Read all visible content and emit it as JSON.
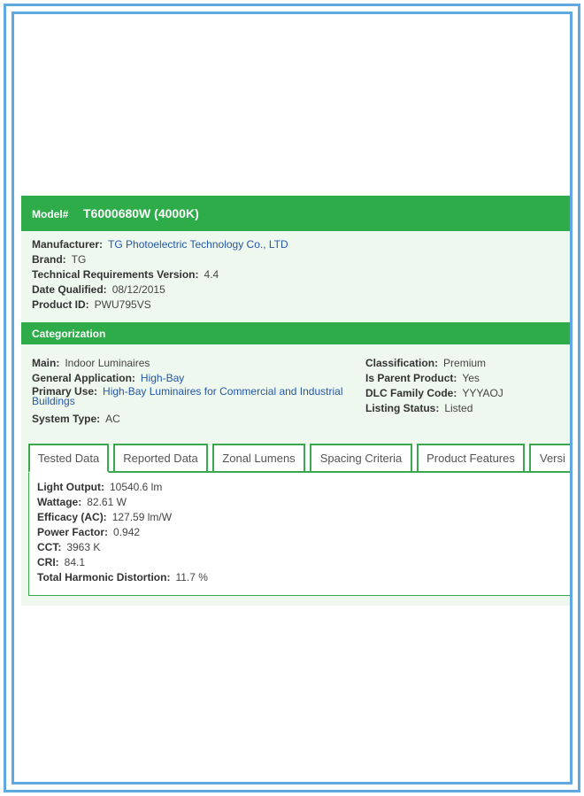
{
  "model": {
    "label": "Model#",
    "value": "T6000680W (4000K)"
  },
  "details": [
    {
      "key": "Manufacturer:",
      "value": "TG Photoelectric Technology Co., LTD",
      "link": true
    },
    {
      "key": "Brand:",
      "value": "TG",
      "link": false
    },
    {
      "key": "Technical Requirements Version:",
      "value": "4.4",
      "link": false
    },
    {
      "key": "Date Qualified:",
      "value": "08/12/2015",
      "link": false
    },
    {
      "key": "Product ID:",
      "value": "PWU795VS",
      "link": false
    }
  ],
  "categorization": {
    "title": "Categorization",
    "left": [
      {
        "key": "Main:",
        "value": "Indoor Luminaires"
      },
      {
        "key": "General Application:",
        "value": "High-Bay"
      },
      {
        "key": "Primary Use:",
        "value": "High-Bay Luminaires for Commercial and Industrial Buildings"
      },
      {
        "key": "System Type:",
        "value": "AC"
      }
    ],
    "right": [
      {
        "key": "Classification:",
        "value": "Premium"
      },
      {
        "key": "Is Parent Product:",
        "value": "Yes"
      },
      {
        "key": "DLC Family Code:",
        "value": "YYYAOJ"
      },
      {
        "key": "Listing Status:",
        "value": "Listed"
      }
    ]
  },
  "tabs": [
    "Tested Data",
    "Reported Data",
    "Zonal Lumens",
    "Spacing Criteria",
    "Product Features",
    "Versi"
  ],
  "tested_data": [
    {
      "key": "Light Output:",
      "value": "10540.6 lm"
    },
    {
      "key": "Wattage:",
      "value": "82.61 W"
    },
    {
      "key": "Efficacy (AC):",
      "value": "127.59 lm/W"
    },
    {
      "key": "Power Factor:",
      "value": "0.942"
    },
    {
      "key": "CCT:",
      "value": "3963 K"
    },
    {
      "key": "CRI:",
      "value": "84.1"
    },
    {
      "key": "Total Harmonic Distortion:",
      "value": "11.7 %"
    }
  ]
}
